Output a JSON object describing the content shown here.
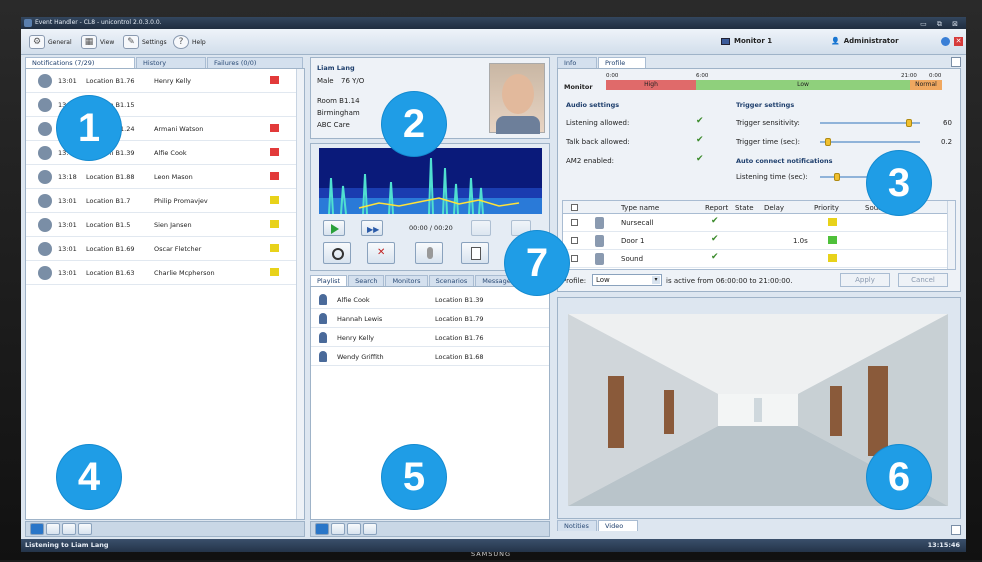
{
  "window": {
    "title": "Event Handler - CL8 - unicontrol 2.0.3.0.0.",
    "controls": "▭ ⧉ ⊠"
  },
  "menu": {
    "general": "General",
    "view": "View",
    "settings": "Settings",
    "help": "Help"
  },
  "header": {
    "monitor_label": "Monitor 1",
    "user_label": "Administrator"
  },
  "notifications": {
    "tabs": [
      "Notifications (7/29)",
      "History",
      "Failures (0/0)"
    ],
    "rows": [
      {
        "time": "13:01",
        "location": "Location B1.76",
        "name": "Henry Kelly",
        "flag": "red"
      },
      {
        "time": "13:",
        "location": "Location B1.15",
        "name": "",
        "flag": "none"
      },
      {
        "time": "13:",
        "location": "Location B1.24",
        "name": "Armani Watson",
        "flag": "red"
      },
      {
        "time": "13:",
        "location": "Location B1.39",
        "name": "Alfie Cook",
        "flag": "red"
      },
      {
        "time": "13:18",
        "location": "Location B1.88",
        "name": "Leon Mason",
        "flag": "red"
      },
      {
        "time": "13:01",
        "location": "Location B1.7",
        "name": "Philip Promavjev",
        "flag": "yellow"
      },
      {
        "time": "13:01",
        "location": "Location B1.5",
        "name": "Sien Jansen",
        "flag": "yellow"
      },
      {
        "time": "13:01",
        "location": "Location B1.69",
        "name": "Oscar Fletcher",
        "flag": "yellow"
      },
      {
        "time": "13:01",
        "location": "Location B1.63",
        "name": "Charlie Mcpherson",
        "flag": "yellow"
      }
    ]
  },
  "person": {
    "name": "Liam Lang",
    "gender": "Male",
    "age": "76 Y/O",
    "room": "Room B1.14",
    "city": "Birmingham",
    "care": "ABC Care"
  },
  "player": {
    "time": "00:00 / 00:20"
  },
  "playlist": {
    "tabs": [
      "Playlist",
      "Search",
      "Monitors",
      "Scenarios",
      "Messages"
    ],
    "rows": [
      {
        "name": "Alfie Cook",
        "location": "Location B1.39"
      },
      {
        "name": "Hannah Lewis",
        "location": "Location B1.79"
      },
      {
        "name": "Henry Kelly",
        "location": "Location B1.76"
      },
      {
        "name": "Wendy Griffith",
        "location": "Location B1.68"
      }
    ]
  },
  "profile": {
    "tabs": [
      "Info",
      "Profile"
    ],
    "monitor_label": "Monitor",
    "timeline": {
      "t0": "0:00",
      "t1": "6:00",
      "t2": "21:00",
      "t3": "0:00",
      "seg_high": "High",
      "seg_low": "Low",
      "seg_normal": "Normal"
    },
    "audio_title": "Audio settings",
    "audio": [
      {
        "label": "Listening allowed:"
      },
      {
        "label": "Talk back allowed:"
      },
      {
        "label": "AM2 enabled:"
      }
    ],
    "trigger_title": "Trigger settings",
    "trigger": [
      {
        "label": "Trigger sensitivity:",
        "value": "60",
        "level": 0.92
      },
      {
        "label": "Trigger time (sec):",
        "value": "0.2",
        "level": 0.05
      }
    ],
    "auto_title": "Auto connect notifications",
    "auto": {
      "label": "Listening time (sec):",
      "level": 0.15
    },
    "table_headers": [
      "Type name",
      "Report",
      "State",
      "Delay",
      "Priority",
      "Sound"
    ],
    "table_rows": [
      {
        "type": "Nursecall",
        "delay": "",
        "flag": "yellow"
      },
      {
        "type": "Door 1",
        "delay": "1.0s",
        "flag": "green"
      },
      {
        "type": "Sound",
        "delay": "",
        "flag": "yellow"
      }
    ],
    "footer_label": "Profile:",
    "footer_value": "Low",
    "footer_text": "is active from 06:00:00 to 21:00:00.",
    "apply": "Apply",
    "cancel": "Cancel"
  },
  "video": {
    "tabs": [
      "Notities",
      "Video"
    ]
  },
  "callouts": [
    "1",
    "2",
    "3",
    "4",
    "5",
    "6",
    "7"
  ],
  "status": {
    "text": "Listening to Liam Lang",
    "time": "13:15:46"
  },
  "brand": "SAMSUNG",
  "colors": {
    "accent": "#1f9de6",
    "red_flag": "#e23a3a",
    "yellow_flag": "#e8d21a",
    "green_flag": "#4fc03a",
    "high": "#e06a6a",
    "low": "#8fd07c",
    "normal": "#f0a860"
  }
}
